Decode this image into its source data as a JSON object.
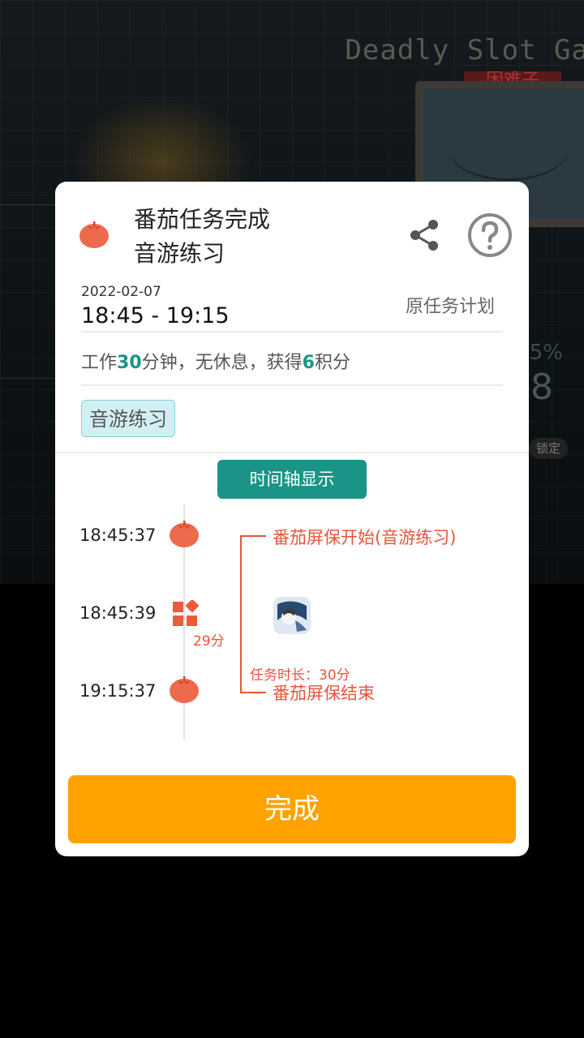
{
  "background": {
    "game_title": "Deadly Slot Ga",
    "game_subtitle": "困难子",
    "hud_percent": "5%",
    "hud_number": "8",
    "lock_label": "锁定"
  },
  "dialog": {
    "title_line1": "番茄任务完成",
    "title_line2": "音游练习",
    "date": "2022-02-07",
    "time_range": "18:45 - 19:15",
    "original_plan_label": "原任务计划",
    "summary": {
      "work_prefix": "工作",
      "work_minutes": "30",
      "work_suffix": "分钟，无休息，获得",
      "points": "6",
      "points_suffix": "积分"
    },
    "tag": "音游练习",
    "timeline_button": "时间轴显示",
    "timeline": {
      "events": [
        {
          "time": "18:45:37",
          "icon": "tomato-icon",
          "label": "番茄屏保开始(音游练习)"
        },
        {
          "time": "18:45:39",
          "icon": "apps-grid-icon",
          "duration": "29分",
          "app_icon": "game-app-icon"
        },
        {
          "time": "19:15:37",
          "icon": "tomato-icon",
          "label": "番茄屏保结束"
        }
      ],
      "task_duration": "任务时长：30分"
    },
    "done_button": "完成"
  },
  "colors": {
    "accent_teal": "#1a9486",
    "tomato_red": "#ee6a4c",
    "timeline_red": "#e8553a",
    "done_orange": "#ffa200",
    "tag_bg": "#d2f0f4"
  }
}
